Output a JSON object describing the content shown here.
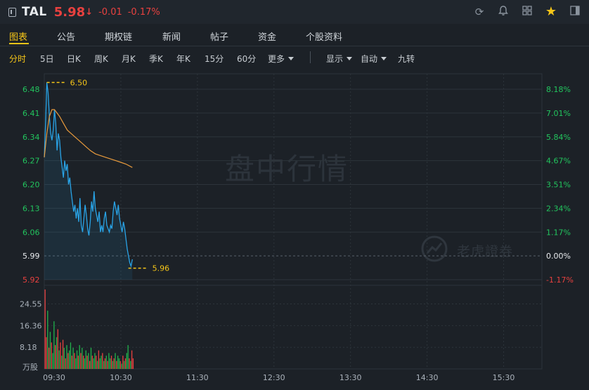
{
  "header": {
    "ticker": "TAL",
    "price": "5.98",
    "arrow": "↓",
    "change": "-0.01",
    "change_pct": "-0.17%",
    "up_color": "#e8413f"
  },
  "tabs": [
    {
      "label": "图表",
      "active": true
    },
    {
      "label": "公告"
    },
    {
      "label": "期权链"
    },
    {
      "label": "新闻"
    },
    {
      "label": "帖子"
    },
    {
      "label": "资金"
    },
    {
      "label": "个股资料"
    }
  ],
  "periods": [
    {
      "label": "分时",
      "active": true
    },
    {
      "label": "5日"
    },
    {
      "label": "日K"
    },
    {
      "label": "周K"
    },
    {
      "label": "月K"
    },
    {
      "label": "季K"
    },
    {
      "label": "年K"
    },
    {
      "label": "15分"
    },
    {
      "label": "60分"
    },
    {
      "label": "更多",
      "dropdown": true
    }
  ],
  "options": [
    {
      "label": "显示",
      "dropdown": true
    },
    {
      "label": "自动",
      "dropdown": true
    },
    {
      "label": "九转"
    }
  ],
  "watermark": {
    "main": "盘中行情",
    "brand": "老虎證券"
  },
  "chart_data": {
    "type": "line",
    "y_ticks": [
      6.48,
      6.41,
      6.34,
      6.27,
      6.2,
      6.13,
      6.06,
      5.99,
      5.92
    ],
    "pct_ticks": [
      "8.18%",
      "7.01%",
      "5.84%",
      "4.67%",
      "3.51%",
      "2.34%",
      "1.17%",
      "0.00%",
      "-1.17%"
    ],
    "prev_close": 5.99,
    "ylim": [
      5.92,
      6.48
    ],
    "x_ticks": [
      "09:30",
      "10:30",
      "11:30",
      "12:30",
      "13:30",
      "14:30",
      "15:30"
    ],
    "x_range": [
      "09:30",
      "16:00"
    ],
    "high_label": "6.50",
    "low_label": "5.96",
    "volume_ticks": [
      "24.55",
      "16.36",
      "8.18"
    ],
    "volume_unit": "万股",
    "volume_max": 30,
    "price_minutes": [
      0,
      1,
      2,
      3,
      4,
      5,
      6,
      7,
      8,
      9,
      10,
      11,
      12,
      13,
      14,
      15,
      16,
      17,
      18,
      19,
      20,
      21,
      22,
      23,
      24,
      25,
      26,
      27,
      28,
      29,
      30,
      31,
      32,
      33,
      34,
      35,
      36,
      37,
      38,
      39,
      40,
      41,
      42,
      43,
      44,
      45,
      46,
      47,
      48,
      49,
      50,
      51,
      52,
      53,
      54,
      55,
      56,
      57,
      58,
      59,
      60,
      61,
      62,
      63,
      64,
      65,
      66,
      67,
      68,
      69
    ],
    "price": [
      6.28,
      6.38,
      6.5,
      6.47,
      6.4,
      6.35,
      6.33,
      6.36,
      6.42,
      6.38,
      6.3,
      6.35,
      6.33,
      6.28,
      6.25,
      6.22,
      6.27,
      6.24,
      6.26,
      6.2,
      6.22,
      6.18,
      6.15,
      6.12,
      6.14,
      6.1,
      6.13,
      6.09,
      6.16,
      6.08,
      6.06,
      6.1,
      6.14,
      6.11,
      6.07,
      6.05,
      6.09,
      6.15,
      6.12,
      6.18,
      6.13,
      6.11,
      6.09,
      6.12,
      6.06,
      6.08,
      6.06,
      6.1,
      6.12,
      6.08,
      6.07,
      6.06,
      6.08,
      6.07,
      6.12,
      6.15,
      6.13,
      6.11,
      6.14,
      6.1,
      6.08,
      6.06,
      6.09,
      6.07,
      6.04,
      6.01,
      5.99,
      5.97,
      5.96,
      5.98
    ],
    "avg_minutes": [
      0,
      2,
      4,
      6,
      8,
      10,
      12,
      15,
      18,
      21,
      24,
      27,
      30,
      33,
      36,
      40,
      44,
      48,
      52,
      56,
      60,
      64,
      69
    ],
    "avg": [
      6.28,
      6.35,
      6.4,
      6.42,
      6.42,
      6.41,
      6.4,
      6.38,
      6.36,
      6.35,
      6.34,
      6.33,
      6.32,
      6.31,
      6.3,
      6.29,
      6.285,
      6.28,
      6.275,
      6.27,
      6.265,
      6.26,
      6.25
    ],
    "volume": [
      30,
      12,
      22,
      8,
      14,
      10,
      6,
      18,
      9,
      12,
      15,
      7,
      10,
      5,
      11,
      8,
      4,
      9,
      6,
      7,
      10,
      5,
      8,
      6,
      4,
      7,
      5,
      9,
      6,
      8,
      5,
      4,
      7,
      5,
      6,
      3,
      8,
      5,
      4,
      6,
      5,
      3,
      7,
      4,
      5,
      6,
      3,
      4,
      5,
      3,
      6,
      4,
      5,
      3,
      4,
      6,
      3,
      5,
      4,
      3,
      2,
      5,
      3,
      4,
      6,
      9,
      4,
      3,
      7,
      4
    ],
    "volume_up": [
      true,
      true,
      false,
      true,
      false,
      true,
      false,
      false,
      true,
      false,
      true,
      false,
      true,
      false,
      true,
      false,
      true,
      false,
      true,
      false,
      false,
      true,
      false,
      true,
      false,
      false,
      true,
      false,
      true,
      false,
      true,
      false,
      false,
      true,
      false,
      true,
      false,
      true,
      false,
      false,
      true,
      false,
      true,
      false,
      false,
      true,
      false,
      true,
      false,
      true,
      false,
      false,
      true,
      false,
      true,
      false,
      true,
      false,
      false,
      true,
      false,
      true,
      false,
      true,
      false,
      false,
      true,
      false,
      true,
      true
    ],
    "colors": {
      "price": "#29a3e6",
      "avg": "#e89a3c",
      "up": "#e8413f",
      "down": "#22b24c",
      "grid": "#2d343b",
      "axis_green": "#22c55e",
      "axis_red": "#e8413f",
      "label": "#f5c518"
    }
  }
}
